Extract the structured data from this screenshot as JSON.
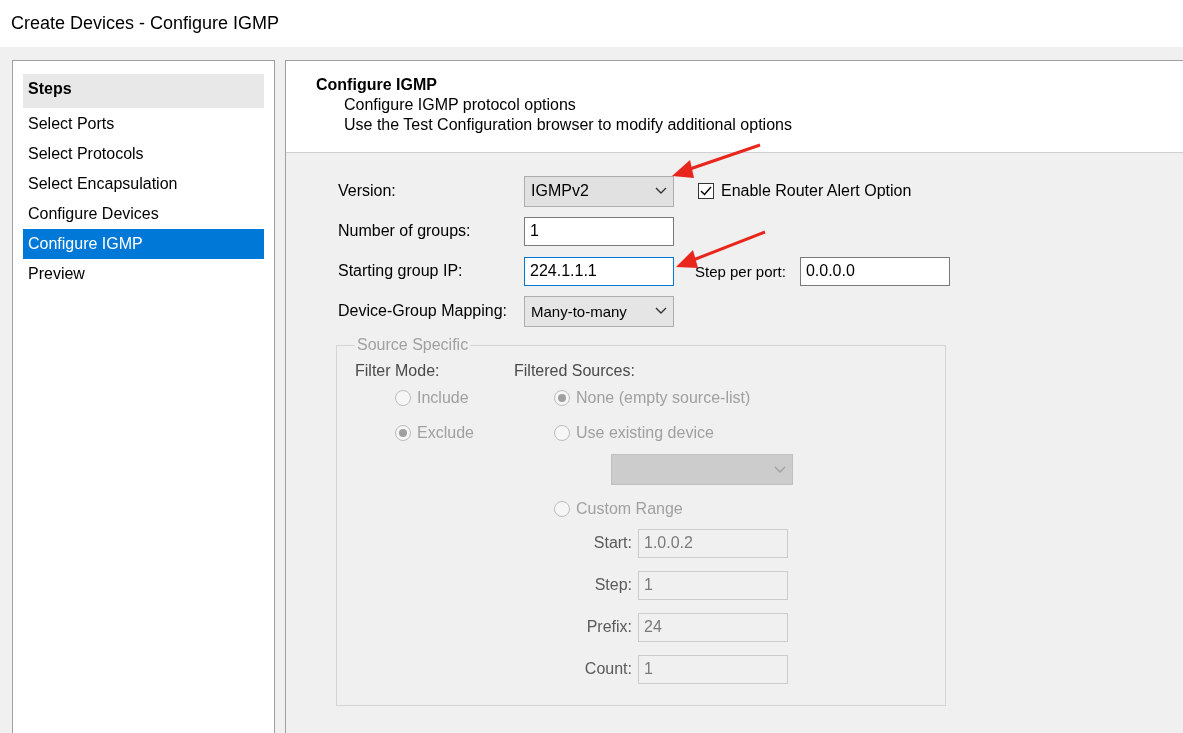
{
  "window": {
    "title": "Create Devices - Configure IGMP"
  },
  "steps": {
    "title": "Steps",
    "items": [
      {
        "label": "Select Ports",
        "selected": false
      },
      {
        "label": "Select Protocols",
        "selected": false
      },
      {
        "label": "Select Encapsulation",
        "selected": false
      },
      {
        "label": "Configure Devices",
        "selected": false
      },
      {
        "label": "Configure IGMP",
        "selected": true
      },
      {
        "label": "Preview",
        "selected": false
      }
    ]
  },
  "header": {
    "title": "Configure IGMP",
    "lines": [
      "Configure IGMP protocol options",
      "Use the Test Configuration browser to modify additional options"
    ]
  },
  "form": {
    "version": {
      "label": "Version:",
      "value": "IGMPv2"
    },
    "router_alert": {
      "label": "Enable Router Alert Option",
      "checked": true
    },
    "groups": {
      "label": "Number of groups:",
      "value": "1"
    },
    "start_ip": {
      "label": "Starting group IP:",
      "value": "224.1.1.1",
      "focused": true
    },
    "step_per_port": {
      "label": "Step per port:",
      "value": "0.0.0.0"
    },
    "mapping": {
      "label": "Device-Group Mapping:",
      "value": "Many-to-many"
    }
  },
  "source_specific": {
    "title": "Source Specific",
    "disabled": true,
    "filter_mode": {
      "label": "Filter Mode:",
      "options": [
        {
          "label": "Include",
          "selected": false
        },
        {
          "label": "Exclude",
          "selected": true
        }
      ]
    },
    "filtered_sources": {
      "label": "Filtered Sources:",
      "options": [
        {
          "kind": "plain",
          "label": "None (empty source-list)",
          "selected": true
        },
        {
          "kind": "device",
          "label": "Use existing device",
          "selected": false
        },
        {
          "kind": "range",
          "label": "Custom Range",
          "selected": false,
          "fields": [
            {
              "label": "Start:",
              "value": "1.0.0.2"
            },
            {
              "label": "Step:",
              "value": "1"
            },
            {
              "label": "Prefix:",
              "value": "24"
            },
            {
              "label": "Count:",
              "value": "1"
            }
          ]
        }
      ]
    }
  }
}
